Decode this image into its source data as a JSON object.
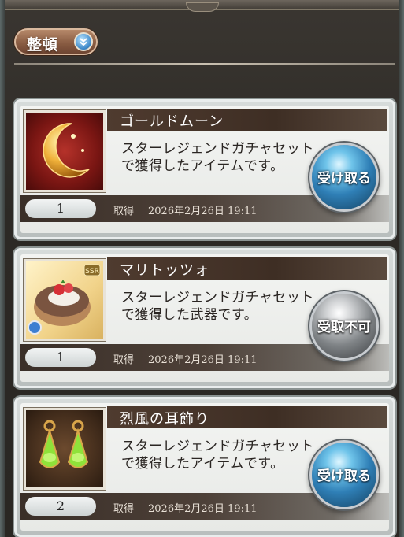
{
  "toolbar": {
    "sort_label": "整頓",
    "sort_icon": "double-chevron-down-icon"
  },
  "colors": {
    "receive_orb": "#2f7fb6",
    "disabled_orb": "#7f8386",
    "title_bar": "#4f3b2f"
  },
  "items": [
    {
      "name": "ゴールドムーン",
      "description": "スターレジェンドガチャセットで獲得したアイテムです。",
      "quantity": "1",
      "acquired_label": "取得",
      "acquired_date": "2026年2月26日 19:11",
      "action_label": "受け取る",
      "thumbnail": "gold-moon-icon"
    },
    {
      "name": "マリトッツォ",
      "description": "スターレジェンドガチャセットで獲得した武器です。",
      "quantity": "1",
      "acquired_label": "取得",
      "acquired_date": "2026年2月26日 19:11",
      "action_label": "受取不可",
      "thumbnail": "maritozzo-weapon-icon",
      "rarity_badge": "SSR"
    },
    {
      "name": "烈風の耳飾り",
      "description": "スターレジェンドガチャセットで獲得したアイテムです。",
      "quantity": "2",
      "acquired_label": "取得",
      "acquired_date": "2026年2月26日 19:11",
      "action_label": "受け取る",
      "thumbnail": "wind-earrings-icon"
    }
  ]
}
